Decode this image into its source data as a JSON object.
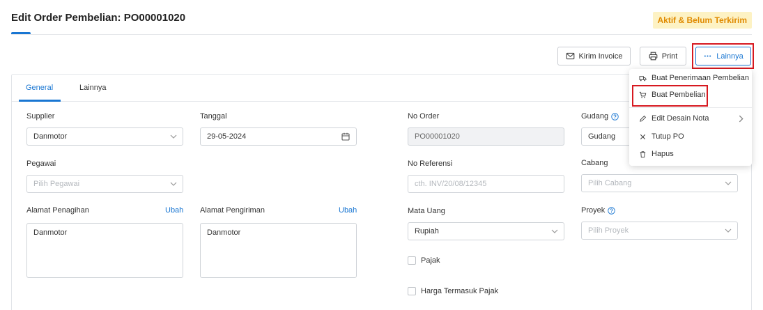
{
  "header": {
    "title": "Edit Order Pembelian: PO00001020",
    "status_badge": "Aktif & Belum Terkirim"
  },
  "toolbar": {
    "kirim_invoice_label": "Kirim Invoice",
    "print_label": "Print",
    "lainnya_label": "Lainnya"
  },
  "tabs": {
    "general": "General",
    "lainnya": "Lainnya"
  },
  "form": {
    "supplier": {
      "label": "Supplier",
      "value": "Danmotor"
    },
    "tanggal": {
      "label": "Tanggal",
      "value": "29-05-2024"
    },
    "no_order": {
      "label": "No Order",
      "value": "PO00001020"
    },
    "gudang": {
      "label": "Gudang",
      "value": "Gudang"
    },
    "pegawai": {
      "label": "Pegawai",
      "placeholder": "Pilih Pegawai"
    },
    "no_referensi": {
      "label": "No Referensi",
      "placeholder": "cth. INV/20/08/12345"
    },
    "cabang": {
      "label": "Cabang",
      "placeholder": "Pilih Cabang"
    },
    "alamat_penagihan": {
      "label": "Alamat Penagihan",
      "link": "Ubah",
      "value": "Danmotor"
    },
    "alamat_pengiriman": {
      "label": "Alamat Pengiriman",
      "link": "Ubah",
      "value": "Danmotor"
    },
    "mata_uang": {
      "label": "Mata Uang",
      "value": "Rupiah"
    },
    "proyek": {
      "label": "Proyek",
      "placeholder": "Pilih Proyek"
    },
    "pajak": {
      "label": "Pajak",
      "checked": false
    },
    "harga_termasuk_pajak": {
      "label": "Harga Termasuk Pajak",
      "checked": false
    }
  },
  "dropdown_menu": {
    "items": [
      {
        "label": "Buat Penerimaan Pembelian",
        "icon": "truck-icon"
      },
      {
        "label": "Buat Pembelian",
        "icon": "cart-icon"
      },
      {
        "label": "Edit Desain Nota",
        "icon": "pencil-icon"
      },
      {
        "label": "Tutup PO",
        "icon": "close-icon"
      },
      {
        "label": "Hapus",
        "icon": "trash-icon"
      }
    ]
  },
  "colors": {
    "accent": "#1976d2",
    "badge_bg": "#fdf2c4",
    "badge_text": "#e08a00",
    "highlight": "#d71920"
  }
}
